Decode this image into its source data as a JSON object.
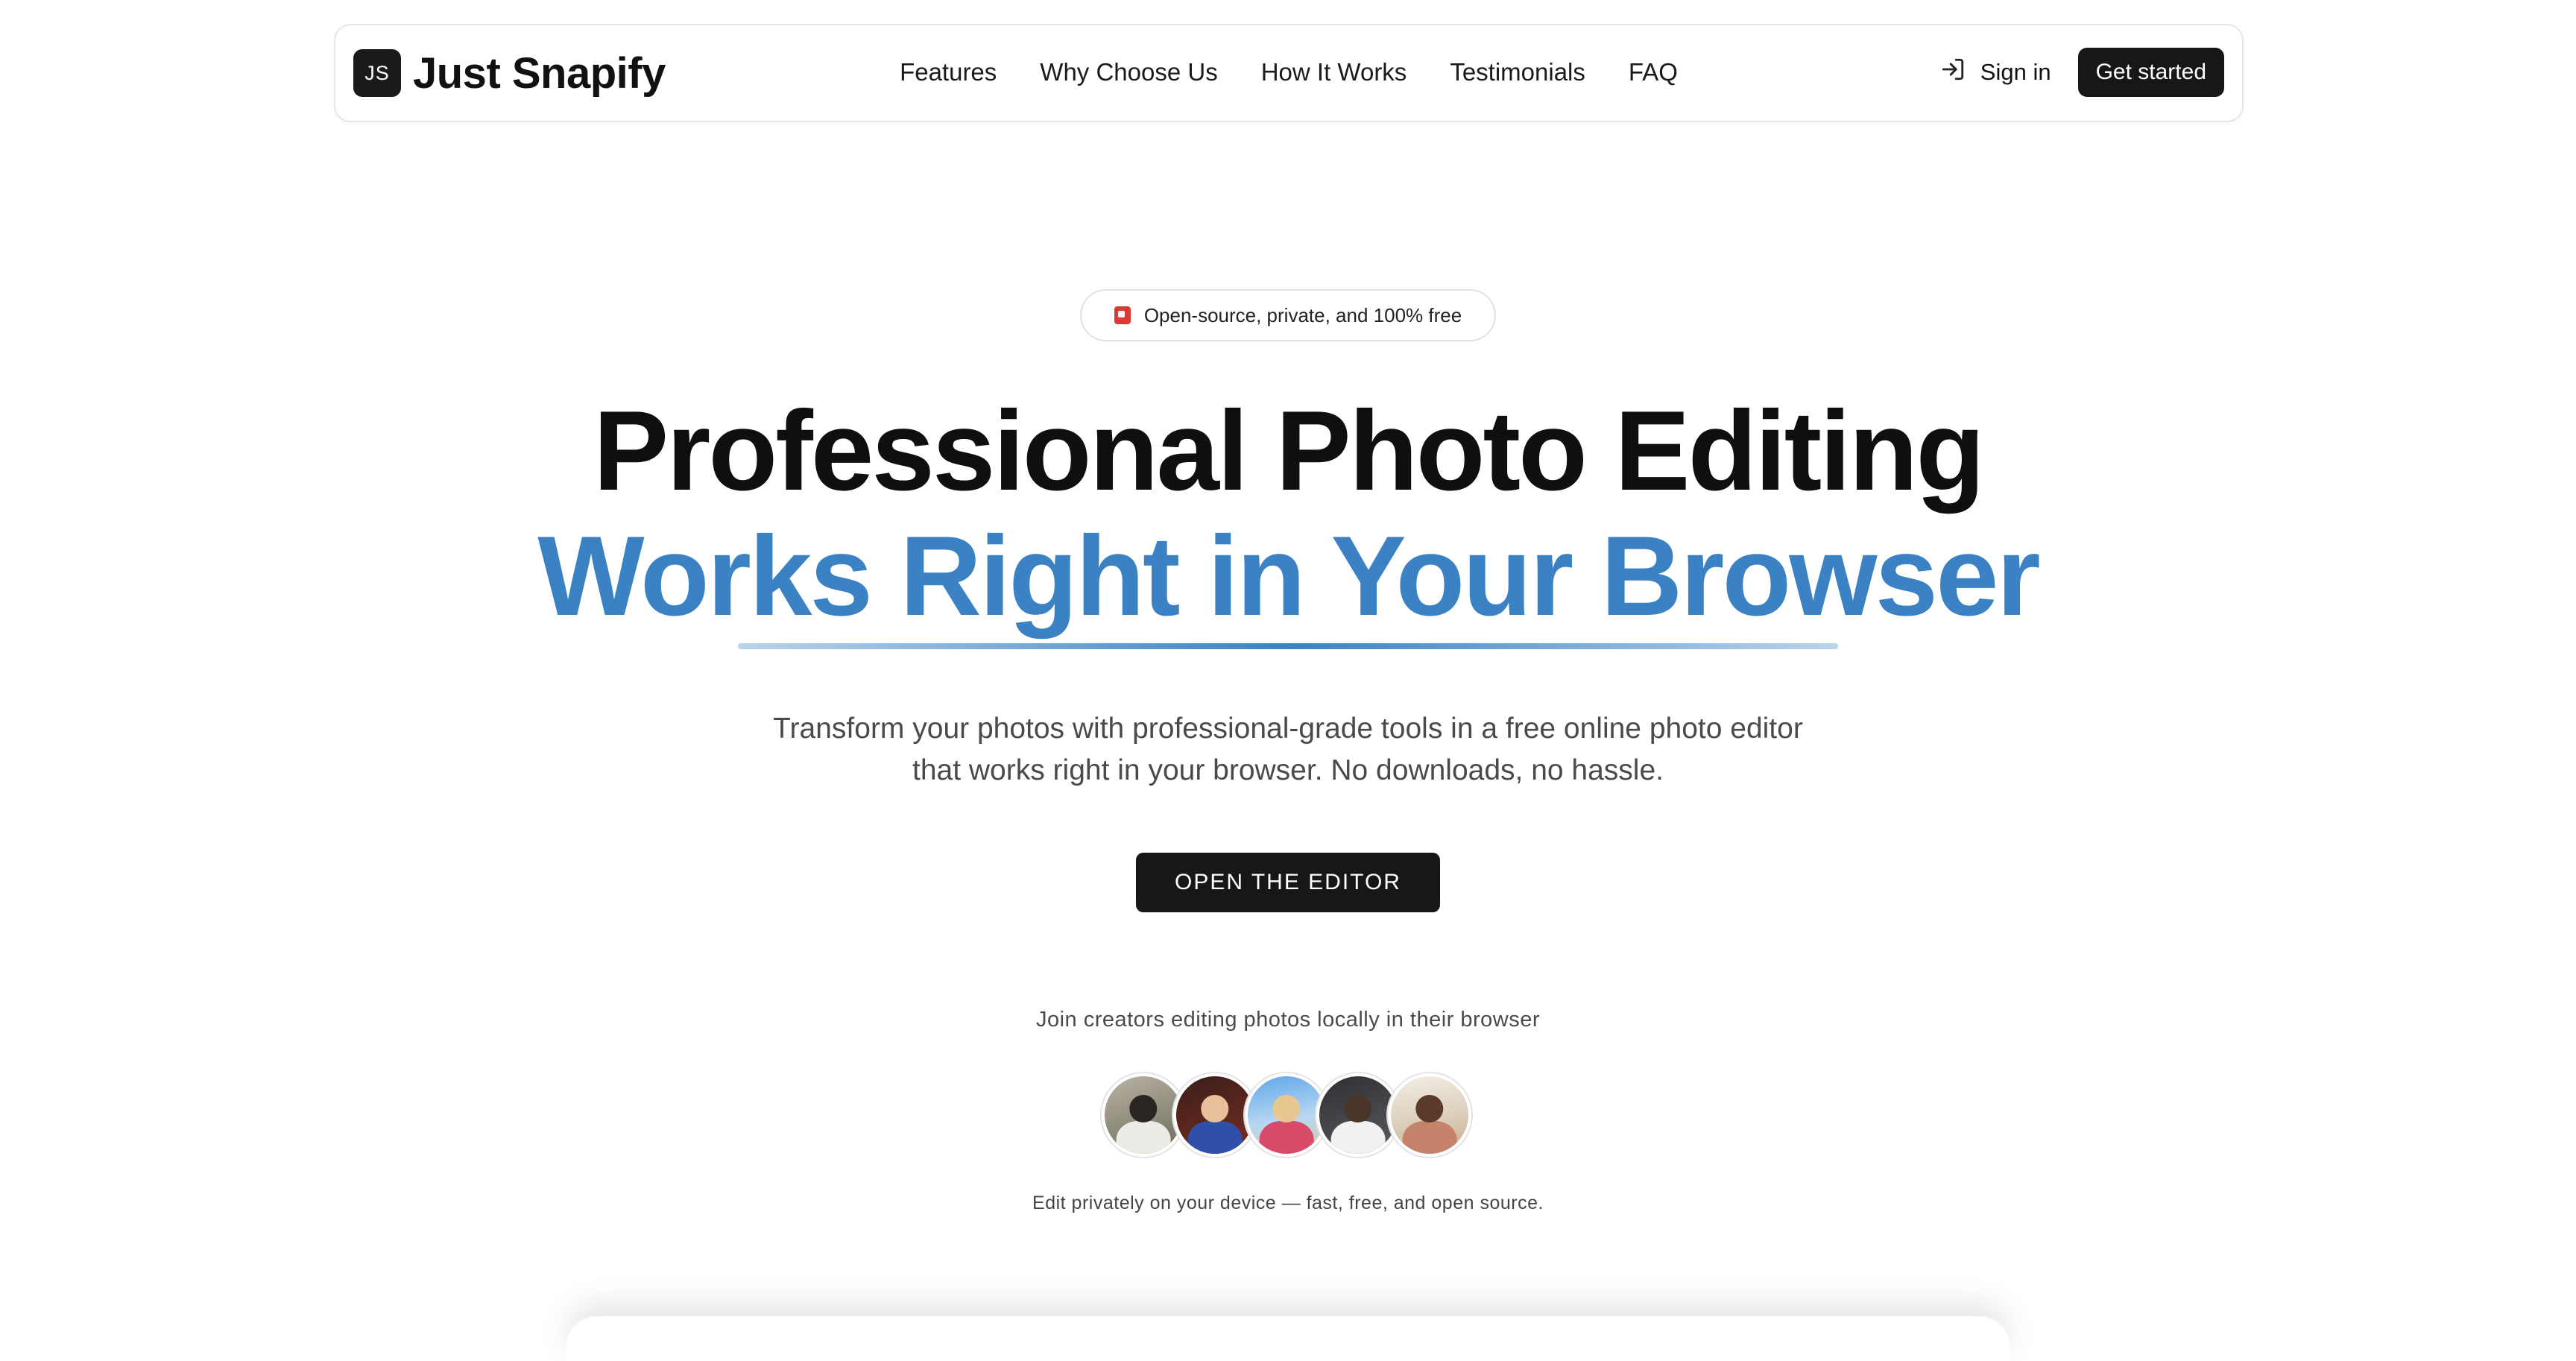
{
  "nav": {
    "logo_text": "JS",
    "brand": "Just Snapify",
    "links": [
      "Features",
      "Why Choose Us",
      "How It Works",
      "Testimonials",
      "FAQ"
    ],
    "signin_label": "Sign in",
    "signin_icon": "log-in-icon",
    "cta_label": "Get started"
  },
  "hero": {
    "badge_icon": "gift-icon",
    "badge_text": "Open-source, private, and 100% free",
    "headline_line1": "Professional Photo Editing",
    "headline_line2": "Works Right in Your Browser",
    "subtext": "Transform your photos with professional-grade tools in a free online photo editor that works right in your browser. No downloads, no hassle.",
    "cta_label": "OPEN THE EDITOR",
    "join_text": "Join creators editing photos locally in their browser",
    "avatar_count": 5,
    "footnote": "Edit privately on your device — fast, free, and open source."
  },
  "colors": {
    "accent": "#3a82c4",
    "dark_button": "#171717",
    "text_primary": "#0f0f0f",
    "text_secondary": "#4a4a4a"
  }
}
